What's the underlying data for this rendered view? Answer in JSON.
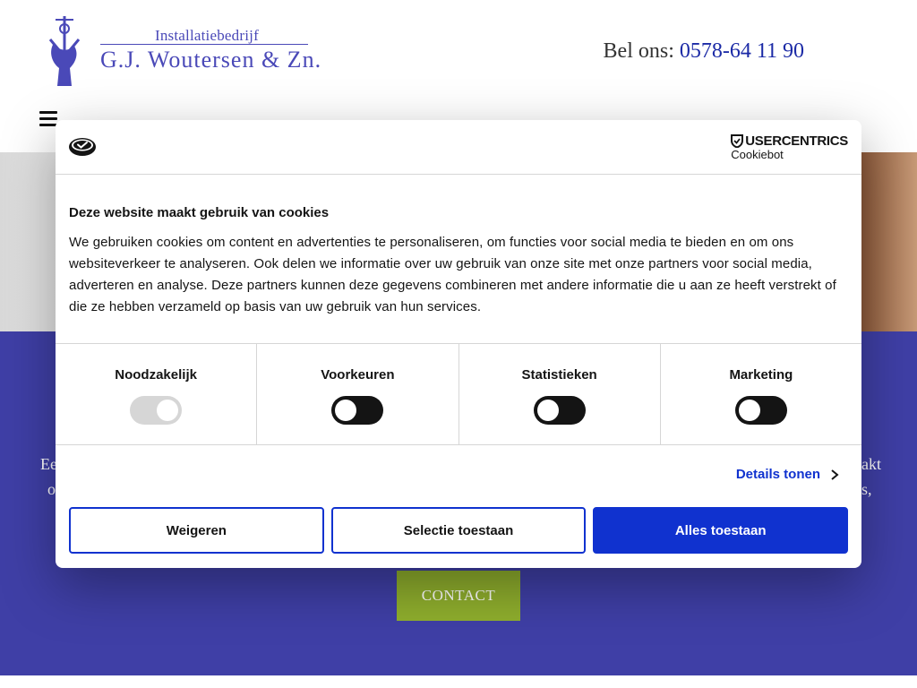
{
  "header": {
    "logo_subtitle": "Installatiebedrijf",
    "logo_name": "G.J. Woutersen & Zn.",
    "phone_label": "Bel ons:",
    "phone_number": "0578-64 11 90"
  },
  "hero": {
    "fragment_left_1": "Ee",
    "fragment_left_2": "o",
    "fragment_right_1": "akt",
    "fragment_right_2": "s,",
    "contact_label": "CONTACT"
  },
  "cookie_dialog": {
    "brand_name": "USERCENTRICS",
    "brand_product": "Cookiebot",
    "title": "Deze website maakt gebruik van cookies",
    "text": "We gebruiken cookies om content en advertenties te personaliseren, om functies voor social media te bieden en om ons websiteverkeer te analyseren. Ook delen we informatie over uw gebruik van onze site met onze partners voor social media, adverteren en analyse. Deze partners kunnen deze gegevens combineren met andere informatie die u aan ze heeft verstrekt of die ze hebben verzameld op basis van uw gebruik van hun services.",
    "categories": [
      {
        "label": "Noodzakelijk",
        "enabled": true,
        "locked": true
      },
      {
        "label": "Voorkeuren",
        "enabled": false,
        "locked": false
      },
      {
        "label": "Statistieken",
        "enabled": false,
        "locked": false
      },
      {
        "label": "Marketing",
        "enabled": false,
        "locked": false
      }
    ],
    "details_label": "Details tonen",
    "buttons": {
      "deny": "Weigeren",
      "allow_selection": "Selectie toestaan",
      "allow_all": "Alles toestaan"
    }
  },
  "colors": {
    "brand_blue": "#4a49b8",
    "hero_band": "#3f3fa6",
    "contact_green": "#8fae2d",
    "cookiebot_blue": "#1032cf"
  },
  "icons": [
    "logo-emblem-icon",
    "menu-icon",
    "cookie-icon",
    "usercentrics-shield-icon",
    "chevron-right-icon"
  ]
}
